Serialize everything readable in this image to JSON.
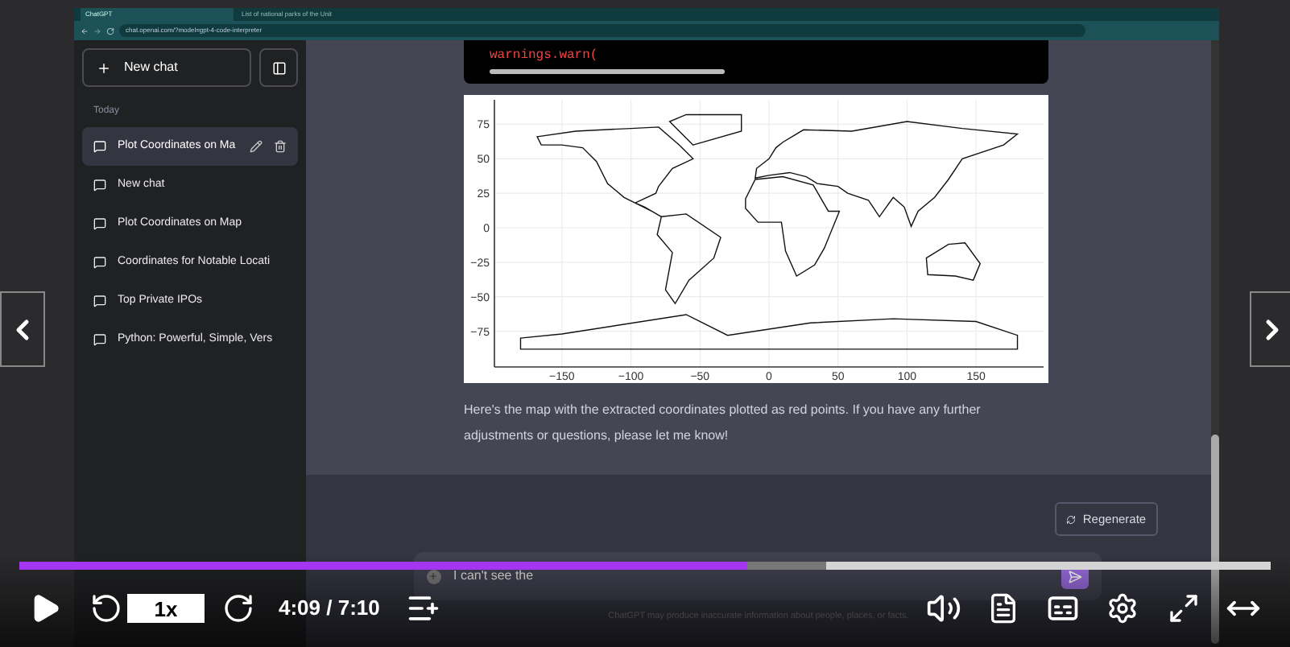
{
  "browser": {
    "tabs": [
      {
        "title": "ChatGPT",
        "selected": true
      },
      {
        "title": "List of national parks of the Unit",
        "selected": false
      }
    ],
    "url": "chat.openai.com/?model=gpt-4-code-interpreter"
  },
  "sidebar": {
    "new_chat": "New chat",
    "section": "Today",
    "items": [
      {
        "title": "Plot Coordinates on Ma",
        "selected": true
      },
      {
        "title": "New chat",
        "selected": false
      },
      {
        "title": "Plot Coordinates on Map",
        "selected": false
      },
      {
        "title": "Coordinates for Notable Locati",
        "selected": false
      },
      {
        "title": "Top Private IPOs",
        "selected": false
      },
      {
        "title": "Python: Powerful, Simple, Vers",
        "selected": false
      }
    ]
  },
  "chat": {
    "code_line": "warnings.warn(",
    "plot": {
      "yticks": [
        "75",
        "50",
        "25",
        "0",
        "−25",
        "−50",
        "−75"
      ],
      "xticks": [
        "−150",
        "−100",
        "−50",
        "0",
        "50",
        "100",
        "150"
      ]
    },
    "message": "Here's the map with the extracted coordinates plotted as red points. If you have any further adjustments or questions, please let me know!",
    "regenerate": "Regenerate",
    "input_value": "I can't see the",
    "footer": "ChatGPT may produce inaccurate information about people, places, or facts."
  },
  "player": {
    "level": 0.582,
    "speed": "1x",
    "time": "4:09 / 7:10"
  }
}
